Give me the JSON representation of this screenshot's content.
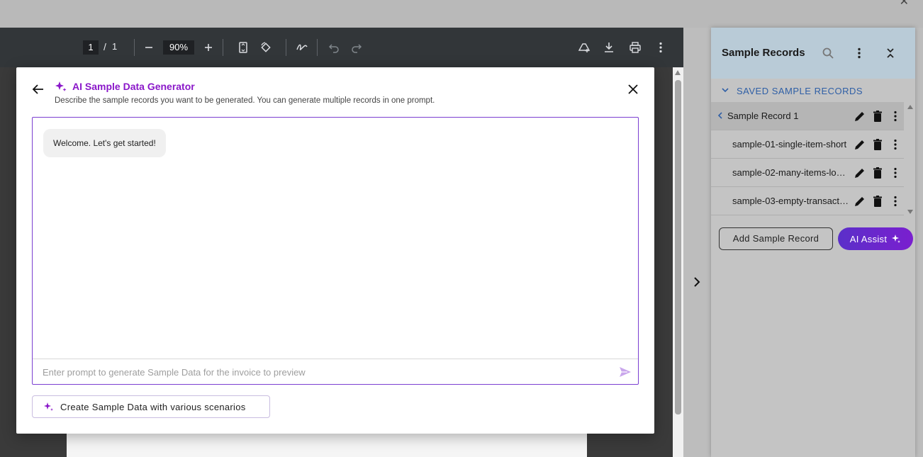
{
  "pdf_toolbar": {
    "page_current": "1",
    "page_separator": "/",
    "page_total": "1",
    "zoom": "90%"
  },
  "right_panel": {
    "title": "Sample Records",
    "saved_header": "SAVED SAMPLE RECORDS",
    "records": [
      {
        "name": "Sample Record 1",
        "selected": true
      },
      {
        "name": "sample-01-single-item-short",
        "selected": false
      },
      {
        "name": "sample-02-many-items-lon...",
        "selected": false
      },
      {
        "name": "sample-03-empty-transacti...",
        "selected": false
      }
    ],
    "add_button": "Add Sample Record",
    "ai_button": "AI Assist"
  },
  "modal": {
    "title": "AI Sample Data Generator",
    "subtitle": "Describe the sample records you want to be generated. You can generate multiple records in one prompt.",
    "welcome_message": "Welcome. Let's get started!",
    "prompt_placeholder": "Enter prompt to generate Sample Data for the invoice to preview",
    "prompt_value": "",
    "scenarios_button": "Create Sample Data with various scenarios"
  },
  "colors": {
    "accent_purple": "#8a17c9",
    "panel_header": "#b9cbd7",
    "link_blue": "#2f5fa6",
    "pdf_toolbar": "#323639"
  }
}
